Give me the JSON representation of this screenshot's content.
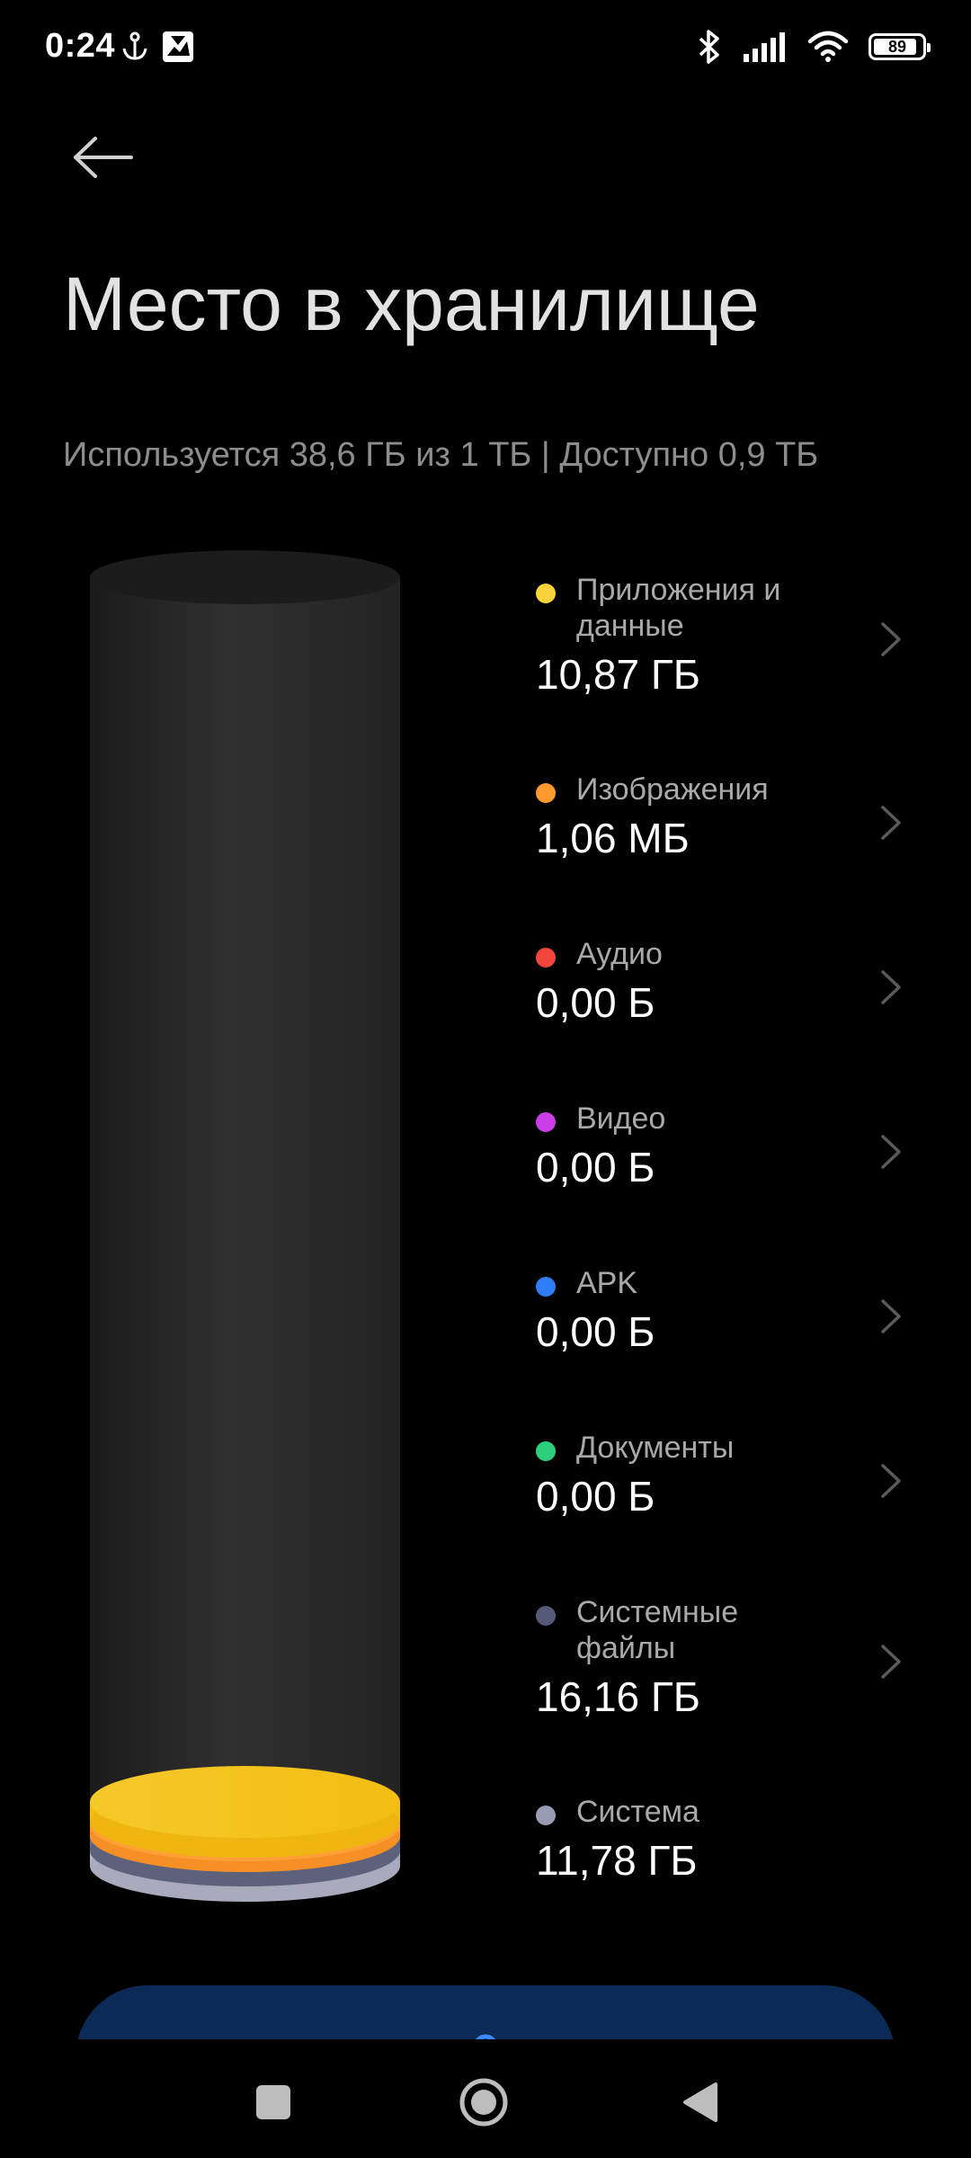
{
  "status_bar": {
    "time": "0:24",
    "battery": "89"
  },
  "page": {
    "title": "Место в хранилище",
    "subtitle": "Используется 38,6 ГБ из 1 ТБ | Доступно 0,9 ТБ"
  },
  "categories": [
    {
      "label": "Приложения и данные",
      "size": "10,87 ГБ",
      "color": "#f8d43a",
      "has_chevron": true
    },
    {
      "label": "Изображения",
      "size": "1,06 МБ",
      "color": "#ff9a2e",
      "has_chevron": true
    },
    {
      "label": "Аудио",
      "size": "0,00 Б",
      "color": "#f2453c",
      "has_chevron": true
    },
    {
      "label": "Видео",
      "size": "0,00 Б",
      "color": "#c93ee6",
      "has_chevron": true
    },
    {
      "label": "APK",
      "size": "0,00 Б",
      "color": "#2f7ef5",
      "has_chevron": true
    },
    {
      "label": "Документы",
      "size": "0,00 Б",
      "color": "#2ecf7c",
      "has_chevron": true
    },
    {
      "label": "Системные файлы",
      "size": "16,16 ГБ",
      "color": "#555a78",
      "has_chevron": true
    },
    {
      "label": "Система",
      "size": "11,78 ГБ",
      "color": "#9a9cb4",
      "has_chevron": false
    }
  ],
  "icons": {
    "back": "arrow-left-icon",
    "bluetooth": "bluetooth-icon",
    "signal": "signal-icon",
    "wifi": "wifi-icon",
    "nav_recents": "square-icon",
    "nav_home": "circle-icon",
    "nav_back": "triangle-back-icon"
  }
}
